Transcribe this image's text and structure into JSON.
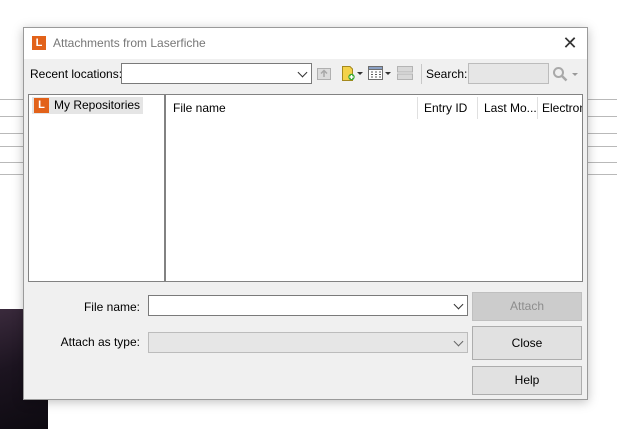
{
  "dialog": {
    "title": "Attachments from Laserfiche",
    "logo_letter": "L",
    "brand_color": "#e2621a"
  },
  "toolbar": {
    "recent_locations_label": "Recent locations:",
    "recent_locations_value": "",
    "search_label": "Search:",
    "search_value": "",
    "icons": [
      "upload-icon",
      "new-folder-icon",
      "view-options-icon",
      "list-view-icon",
      "search-icon"
    ]
  },
  "tree": {
    "items": [
      {
        "label": "My Repositories",
        "icon": "laserfiche-logo-icon",
        "selected": true
      }
    ]
  },
  "file_list": {
    "columns": [
      "File name",
      "Entry ID",
      "Last Mo...",
      "Electron"
    ],
    "rows": []
  },
  "form": {
    "file_name_label": "File name:",
    "file_name_value": "",
    "attach_type_label": "Attach as type:",
    "attach_type_value": ""
  },
  "buttons": {
    "attach": "Attach",
    "close": "Close",
    "help": "Help"
  }
}
